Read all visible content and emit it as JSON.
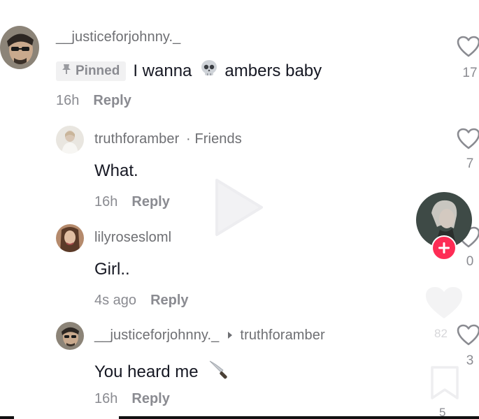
{
  "comments": [
    {
      "username": "__justiceforjohnny._",
      "pinned_label": "Pinned",
      "text_before": "I wanna",
      "emoji_icon": "skull-icon",
      "text_after": "ambers baby",
      "time": "16h",
      "reply_label": "Reply",
      "like_count": "17"
    },
    {
      "username": "truthforamber",
      "friend_label": "· Friends",
      "text": "What.",
      "time": "16h",
      "reply_label": "Reply",
      "like_count": "7"
    },
    {
      "username": "lilyrosesloml",
      "text": "Girl..",
      "time": "4s ago",
      "reply_label": "Reply",
      "like_count": "0"
    },
    {
      "username": "__justiceforjohnny._",
      "reply_to": "truthforamber",
      "text": "You heard me",
      "emoji_icon": "knife-icon",
      "time": "16h",
      "reply_label": "Reply",
      "like_count": "3"
    }
  ],
  "video_overlay": {
    "play_icon": "play-icon",
    "creator_avatar_icon": "creator-avatar",
    "follow_icon": "plus-icon",
    "faded_like_count": "82",
    "faded_bottom_count": "5"
  },
  "colors": {
    "text": "#161823",
    "muted": "#8a8b91",
    "follow_badge": "#fe2c55",
    "pinned_bg": "#f1f1f2"
  }
}
